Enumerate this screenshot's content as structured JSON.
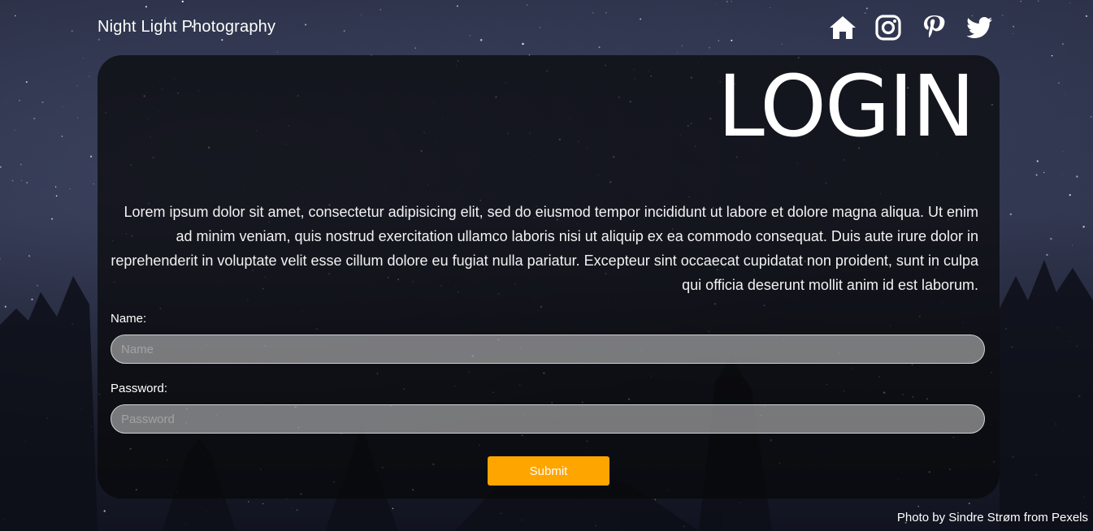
{
  "header": {
    "site_title": "Night Light Photography",
    "nav_icons": [
      "home-icon",
      "instagram-icon",
      "pinterest-icon",
      "twitter-icon"
    ]
  },
  "login": {
    "heading": "LOGIN",
    "intro_text": "Lorem ipsum dolor sit amet, consectetur adipisicing elit, sed do eiusmod tempor incididunt ut labore et dolore magna aliqua. Ut enim ad minim veniam, quis nostrud exercitation ullamco laboris nisi ut aliquip ex ea commodo consequat. Duis aute irure dolor in reprehenderit in voluptate velit esse cillum dolore eu fugiat nulla pariatur. Excepteur sint occaecat cupidatat non proident, sunt in culpa qui officia deserunt mollit anim id est laborum.",
    "name_label": "Name:",
    "name_placeholder": "Name",
    "name_value": "",
    "password_label": "Password:",
    "password_placeholder": "Password",
    "password_value": "",
    "submit_label": "Submit"
  },
  "footer": {
    "photo_credit": "Photo by Sindre Strøm from Pexels"
  },
  "colors": {
    "accent": "#ffa500",
    "card_background": "#08080a",
    "text": "#ffffff"
  }
}
